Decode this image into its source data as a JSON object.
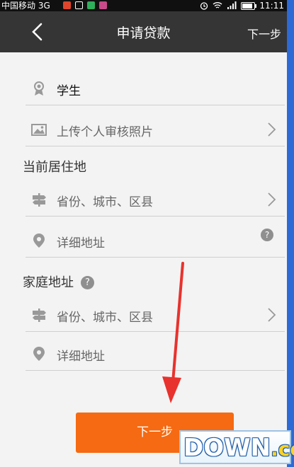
{
  "status_bar": {
    "carrier": "中国移动 3G",
    "time": "11:11",
    "battery_level": 0.85
  },
  "header": {
    "title": "申请贷款",
    "next_label": "下一步",
    "back_icon": "chevron-left-icon"
  },
  "form": {
    "identity": {
      "value": "学生",
      "icon": "award-icon"
    },
    "photo_upload": {
      "label": "上传个人审核照片",
      "icon": "image-icon"
    },
    "current_residence": {
      "title": "当前居住地",
      "region_placeholder": "省份、城市、区县",
      "detail_placeholder": "详细地址"
    },
    "home_address": {
      "title": "家庭地址",
      "region_placeholder": "省份、城市、区县",
      "detail_placeholder": "详细地址"
    },
    "help_mark": "?"
  },
  "submit_label": "下一步",
  "watermark": {
    "main": "DOWN",
    "suffix": ".cc"
  },
  "colors": {
    "nav_bg": "#353535",
    "accent": "#f56a12",
    "annotation_red": "#e8322d",
    "frame_blue": "#2d6ad6"
  }
}
